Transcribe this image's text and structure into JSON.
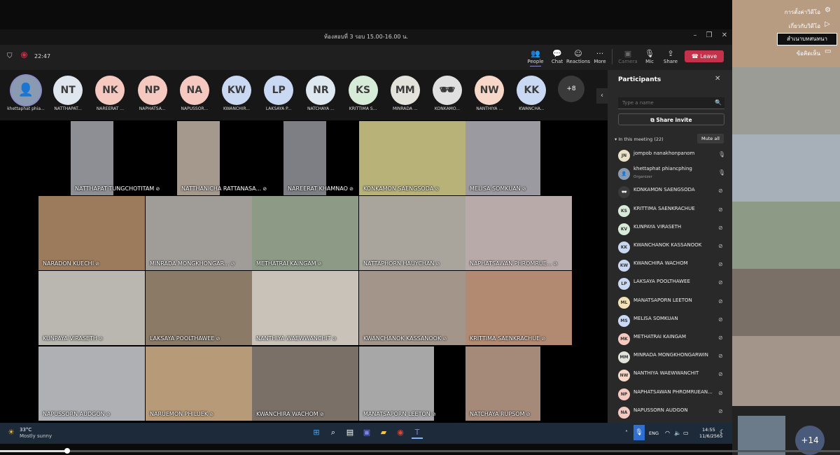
{
  "window": {
    "title": "ห้องสอบที่ 3 รอบ 15.00-16.00 น.",
    "timer": "22:47"
  },
  "toolbar": {
    "people": "People",
    "chat": "Chat",
    "reactions": "Reactions",
    "more": "More",
    "camera": "Camera",
    "mic": "Mic",
    "share": "Share",
    "leave": "Leave"
  },
  "avatars": [
    {
      "initials": "",
      "label": "khettaphat phia...",
      "color": "#8a9ab0",
      "photo": true
    },
    {
      "initials": "NT",
      "label": "NATTHAPAT...",
      "color": "#dfe6ee"
    },
    {
      "initials": "NK",
      "label": "NAREERAT ...",
      "color": "#f5c9c0"
    },
    {
      "initials": "NP",
      "label": "NAPHATSA...",
      "color": "#f5c9c0"
    },
    {
      "initials": "NA",
      "label": "NAPUSSOR...",
      "color": "#f5c9c0"
    },
    {
      "initials": "KW",
      "label": "KWANCHIR...",
      "color": "#c9d8f3"
    },
    {
      "initials": "LP",
      "label": "LAKSAYA P...",
      "color": "#c9d8f3"
    },
    {
      "initials": "NR",
      "label": "NATCHAYA ...",
      "color": "#dde8f0"
    },
    {
      "initials": "KS",
      "label": "KRITTIMA S...",
      "color": "#d7ecd8"
    },
    {
      "initials": "MM",
      "label": "MINRADA ...",
      "color": "#e3e3dc"
    },
    {
      "initials": "",
      "label": "KONKAMO...",
      "color": "#e0e0e0",
      "photo": true
    },
    {
      "initials": "NW",
      "label": "NANTHIYA ...",
      "color": "#f7d8c8"
    },
    {
      "initials": "KK",
      "label": "KWANCHA...",
      "color": "#c9d8f3"
    }
  ],
  "overflow": "+8",
  "videos": [
    {
      "name": "NATTHAPAT TUNGCHOTITAM",
      "color": "#8d8f94"
    },
    {
      "name": "NATTHANICHA RATTANASA...",
      "color": "#a5988d"
    },
    {
      "name": "NAREERAT KHAMNAO",
      "color": "#7d7f84"
    },
    {
      "name": "KONKAMON SAENGSODA",
      "color": "#b8b278"
    },
    {
      "name": "MELISA SOMKUAN",
      "color": "#9a9aa0"
    },
    {
      "name": "NARADON KUECHI",
      "color": "#9c7a5c"
    },
    {
      "name": "MINRADA MONGKHONGAR...",
      "color": "#a09c98"
    },
    {
      "name": "METHATRAI KAINGAM",
      "color": "#8c9a86"
    },
    {
      "name": "NATTAPHORN HAUYCHAN",
      "color": "#a9a49c"
    },
    {
      "name": "NAPHATSAWAN PHROMRUE...",
      "color": "#b8aaa8"
    },
    {
      "name": "KUNPAYA VIRASETH",
      "color": "#b9b7b0"
    },
    {
      "name": "LAKSAYA POOLTHAWEE",
      "color": "#8a7a66"
    },
    {
      "name": "NANTHIYA WAEWWANCHIT",
      "color": "#c8c2b8"
    },
    {
      "name": "KWANCHANOK KASSANOOK",
      "color": "#a3958a"
    },
    {
      "name": "KRITTIMA SAENKRACHUE",
      "color": "#b28a72"
    },
    {
      "name": "NAPUSSORN AUDGON",
      "color": "#aeb0b4"
    },
    {
      "name": "NARUEMON PHILUEK",
      "color": "#b79a78"
    },
    {
      "name": "KWANCHIRA WACHOM",
      "color": "#7a7068"
    },
    {
      "name": "MANATSAPORN LEETON",
      "color": "#a7a7a7"
    },
    {
      "name": "NATCHAYA RUPSOM",
      "color": "#a58a7a"
    }
  ],
  "panel": {
    "title": "Participants",
    "search_placeholder": "Type a name",
    "invite": "Share invite",
    "in_meeting": "In this meeting (22)",
    "mute_all": "Mute all",
    "participants": [
      {
        "initials": "JN",
        "name": "jompob nanakhonpanom",
        "color": "#e9e2c8",
        "muted": false
      },
      {
        "initials": "",
        "name": "khettaphat phiancphing",
        "role": "Organizer",
        "color": "#8a9ab0",
        "muted": false,
        "photo": true
      },
      {
        "initials": "",
        "name": "KONKAMON SAENGSODA",
        "color": "#3a3a3a",
        "muted": true,
        "photo": true
      },
      {
        "initials": "KS",
        "name": "KRITTIMA SAENKRACHUE",
        "color": "#d7ecd8",
        "muted": true
      },
      {
        "initials": "KV",
        "name": "KUNPAYA VIRASETH",
        "color": "#d7ecd8",
        "muted": true
      },
      {
        "initials": "KK",
        "name": "KWANCHANOK KASSANOOK",
        "color": "#c9d8f3",
        "muted": true
      },
      {
        "initials": "KW",
        "name": "KWANCHIRA WACHOM",
        "color": "#c9d8f3",
        "muted": true
      },
      {
        "initials": "LP",
        "name": "LAKSAYA POOLTHAWEE",
        "color": "#c9d8f3",
        "muted": true
      },
      {
        "initials": "ML",
        "name": "MANATSAPORN LEETON",
        "color": "#f3e2b8",
        "muted": true
      },
      {
        "initials": "MS",
        "name": "MELISA SOMKUAN",
        "color": "#c9d8f3",
        "muted": true
      },
      {
        "initials": "MK",
        "name": "METHATRAI KAINGAM",
        "color": "#f5c9c0",
        "muted": true
      },
      {
        "initials": "MM",
        "name": "MINRADA MONGKHONGARWIN",
        "color": "#e3e3dc",
        "muted": true
      },
      {
        "initials": "NW",
        "name": "NANTHIYA WAEWWANCHIT",
        "color": "#f7d8c8",
        "muted": true
      },
      {
        "initials": "NP",
        "name": "NAPHATSAWAN PHROMRUEAN...",
        "color": "#f5c9c0",
        "muted": true
      },
      {
        "initials": "NA",
        "name": "NAPUSSORN AUDGON",
        "color": "#f5c9c0",
        "muted": true
      }
    ]
  },
  "overlay_menu": [
    "การตั้งค่าวิดีโอ",
    "เกี่ยวกับวิดีโอ",
    "สำเนาบทสนทนา",
    "ข้อคิดเห็น"
  ],
  "taskbar": {
    "temp": "33°C",
    "weather": "Mostly sunny",
    "lang": "ENG",
    "time": "14:55",
    "date": "11/6/2565"
  },
  "player": {
    "progress": 0.08,
    "plus": "+14"
  }
}
